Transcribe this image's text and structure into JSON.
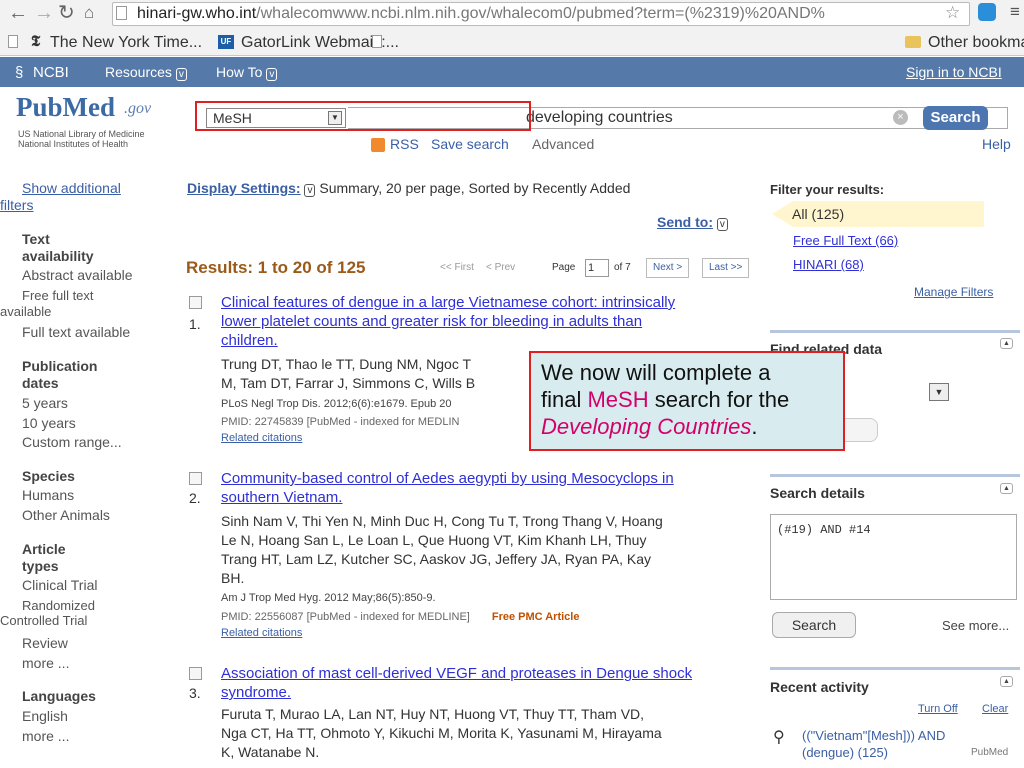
{
  "browser": {
    "url_host": "hinari-gw.who.int",
    "url_path": "/whalecomwww.ncbi.nlm.nih.gov/whalecom0/pubmed?term=(%2319)%20AND%",
    "bookmarks": [
      "The New York Time...",
      "GatorLink Webmail :..."
    ],
    "other_bookmarks": "Other bookmar"
  },
  "ncbi_bar": {
    "brand": "NCBI",
    "resources": "Resources",
    "howto": "How To",
    "signin": "Sign in to NCBI"
  },
  "header": {
    "logo_main": "PubMed",
    "logo_gov": ".gov",
    "logo_sub1": "US National Library of Medicine",
    "logo_sub2": "National Institutes of Health",
    "db_select": "MeSH",
    "search_value": "developing countries",
    "search_button": "Search",
    "rss": "RSS",
    "save_search": "Save search",
    "advanced": "Advanced",
    "help": "Help"
  },
  "sidebar": {
    "show_additional": "Show additional",
    "filters": "filters",
    "text_availability_1": "Text",
    "text_availability_2": "availability",
    "abstract_available": "Abstract available",
    "free_full_text_1": "Free full text",
    "free_full_text_2": "available",
    "full_text_available": "Full text available",
    "pub_dates_1": "Publication",
    "pub_dates_2": "dates",
    "five_years": "5 years",
    "ten_years": "10 years",
    "custom_range": "Custom range...",
    "species": "Species",
    "humans": "Humans",
    "other_animals": "Other Animals",
    "article_types_1": "Article",
    "article_types_2": "types",
    "clinical_trial": "Clinical Trial",
    "rct_1": "Randomized",
    "rct_2": "Controlled Trial",
    "review": "Review",
    "more1": "more ...",
    "languages": "Languages",
    "english": "English",
    "more2": "more ..."
  },
  "main": {
    "display_settings_label": "Display Settings:",
    "display_settings_value": "Summary, 20 per page, Sorted by Recently Added",
    "send_to": "Send to:",
    "results_count": "Results: 1 to 20 of 125",
    "pager": {
      "first": "<< First",
      "prev": "< Prev",
      "page_label": "Page",
      "page": "1",
      "of": "of 7",
      "next": "Next >",
      "last": "Last >>"
    },
    "results": [
      {
        "num": "1.",
        "title1": "Clinical features of dengue in a large Vietnamese cohort: intrinsically",
        "title2": "lower platelet counts and greater risk for bleeding in adults than",
        "title3": "children.",
        "authors1": "Trung DT, Thao le TT, Dung NM, Ngoc T",
        "authors2": "M, Tam DT, Farrar J, Simmons C, Wills B",
        "journal": "PLoS Negl Trop Dis. 2012;6(6):e1679. Epub 20",
        "pmid": "PMID: 22745839 [PubMed - indexed for MEDLIN",
        "related": "Related citations"
      },
      {
        "num": "2.",
        "title1": "Community-based control of Aedes aegypti by using Mesocyclops in",
        "title2": "southern Vietnam.",
        "authors1": "Sinh Nam V, Thi Yen N, Minh Duc H, Cong Tu T, Trong Thang V, Hoang",
        "authors2": "Le N, Hoang San L, Le Loan L, Que Huong VT, Kim Khanh LH, Thuy",
        "authors3": "Trang HT, Lam LZ, Kutcher SC, Aaskov JG, Jeffery JA, Ryan PA, Kay",
        "authors4": "BH.",
        "journal": "Am J Trop Med Hyg. 2012 May;86(5):850-9.",
        "pmid": "PMID: 22556087 [PubMed - indexed for MEDLINE]",
        "free": "Free PMC Article",
        "related": "Related citations"
      },
      {
        "num": "3.",
        "title1": "Association of mast cell-derived VEGF and proteases in Dengue shock",
        "title2": "syndrome.",
        "authors1": "Furuta T, Murao LA, Lan NT, Huy NT, Huong VT, Thuy TT, Tham VD,",
        "authors2": "Nga CT, Ha TT, Ohmoto Y, Kikuchi M, Morita K, Yasunami M, Hirayama",
        "authors3": "K, Watanabe N."
      }
    ]
  },
  "right": {
    "filter_title": "Filter your results:",
    "all": "All (125)",
    "free_full_text": "Free Full Text (66)",
    "hinari": "HINARI (68)",
    "manage_filters": "Manage Filters",
    "find_related": "Find related data",
    "search_details": "Search details",
    "details_query": "(#19) AND #14",
    "details_search": "Search",
    "see_more": "See more...",
    "recent_activity": "Recent activity",
    "turn_off": "Turn Off",
    "clear": "Clear",
    "recent_query1": "((\"Vietnam\"[Mesh])) AND",
    "recent_query2": "(dengue) (125)",
    "recent_db": "PubMed"
  },
  "callout": {
    "line1": "We now will complete a",
    "line2_a": "final ",
    "line2_hl": "MeSH",
    "line2_b": " search for the",
    "line3_hl": "Developing Countries",
    "line3_end": "."
  },
  "colors": {
    "ncbi_bar": "#5579a8",
    "callout_bg": "#d8ecef",
    "highlight_border": "#e02020",
    "callout_accent": "#d4006a"
  }
}
